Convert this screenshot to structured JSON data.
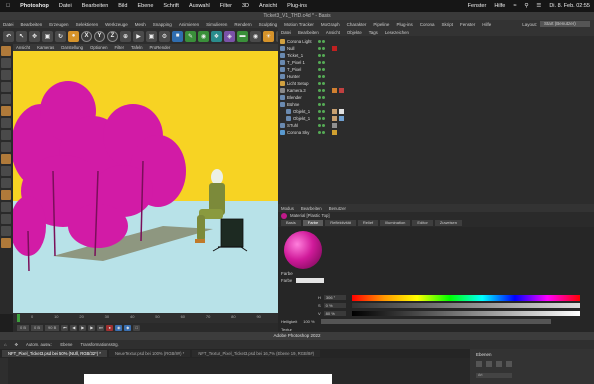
{
  "mac_menubar": {
    "app": "Photoshop",
    "items": [
      "Datei",
      "Bearbeiten",
      "Bild",
      "Ebene",
      "Schrift",
      "Auswahl",
      "Filter",
      "3D",
      "Ansicht",
      "Plug-ins"
    ],
    "right_items": [
      "Fenster",
      "Hilfe"
    ],
    "clock": "Di. 8. Feb.  02:55"
  },
  "c4d": {
    "window_title": "Ticket3_V1_THD.c4d * - Basis",
    "menu": [
      "Datei",
      "Bearbeiten",
      "Erzeugen",
      "Selektieren",
      "Werkzeuge",
      "Mesh",
      "Snapping",
      "Animieren",
      "Simulieren",
      "Rendern",
      "Sculpting",
      "Motion Tracker",
      "MoGraph",
      "Charakter",
      "Pipeline",
      "Plug-ins",
      "Corona",
      "Skript",
      "Fenster",
      "Hilfe"
    ],
    "layout_label": "Layout:",
    "layout_value": "Start (Benutzer)",
    "toolbar_axes": [
      "X",
      "Y",
      "Z"
    ],
    "view_menu": [
      "Ansicht",
      "Kameras",
      "Darstellung",
      "Optionen",
      "Filter",
      "Tafeln",
      "ProRender"
    ],
    "object_menu": [
      "Datei",
      "Bearbeiten",
      "Ansicht",
      "Objekte",
      "Tags",
      "Lesezeichen"
    ],
    "objects": [
      {
        "name": "Corona Light",
        "color": "#d0a040"
      },
      {
        "name": "Null",
        "color": "#8aa0b8"
      },
      {
        "name": "Ticket_1",
        "color": "#6a8ab0"
      },
      {
        "name": "T_Pixel 1",
        "color": "#6a8ab0"
      },
      {
        "name": "T_Pixel",
        "color": "#6a8ab0"
      },
      {
        "name": "Hunter",
        "color": "#6a8ab0"
      },
      {
        "name": "Licht Setup",
        "color": "#d0a040"
      },
      {
        "name": "Kamera.3",
        "color": "#8a8a8a"
      },
      {
        "name": "Blender",
        "color": "#6a8ab0"
      },
      {
        "name": "Bühne",
        "color": "#6a8ab0"
      },
      {
        "name": "Objekt_1",
        "color": "#6a8ab0"
      },
      {
        "name": "Objekt_1",
        "color": "#6a8ab0"
      },
      {
        "name": "STuhl",
        "color": "#6a8ab0"
      },
      {
        "name": "Corona Sky",
        "color": "#5a9ad0"
      }
    ],
    "timeline_ticks": [
      "0",
      "10",
      "20",
      "30",
      "40",
      "50",
      "60",
      "70",
      "80",
      "90"
    ],
    "timeline_frame_start": "0 B",
    "timeline_frame_end": "90 B",
    "timeline_current": "0 B",
    "attr_menu": [
      "Modus",
      "Bearbeiten",
      "Benutzer"
    ],
    "attr_header": "Material [Plastic Top]",
    "attr_tabs": [
      "Basis",
      "Farbe",
      "Reflektivität",
      "Relief",
      "Illumination",
      "Editor",
      "Zuweisen"
    ],
    "attr_active_tab": "Farbe",
    "color_section": "Farbe",
    "color_label": "Farbe",
    "hsv": [
      {
        "label": "H",
        "value": "306 °"
      },
      {
        "label": "S",
        "value": "0 %"
      },
      {
        "label": "V",
        "value": "80 %"
      }
    ],
    "brightness_label": "Helligkeit",
    "brightness_value": "100 %",
    "texture_label": "Textur",
    "material_color": "#d01a9a"
  },
  "photoshop": {
    "title": "Adobe Photoshop 2022",
    "options": [
      "Autom. ausw.:",
      "Ebene",
      "Transformationsstrg."
    ],
    "tabs": [
      {
        "label": "NFT_Pixel_Ticket3.psd bei 50% (NUll, RGB/32*) *",
        "active": true
      },
      {
        "label": "NeueTextur.psd bei 100% (RGB/8#) *",
        "active": false
      },
      {
        "label": "NFT_Textur_Pixel_Ticket3.psd bei 16,7% (Ebene 19, RGB/8#)",
        "active": false
      }
    ],
    "panel_title": "Ebenen",
    "panel_search": "Art"
  }
}
